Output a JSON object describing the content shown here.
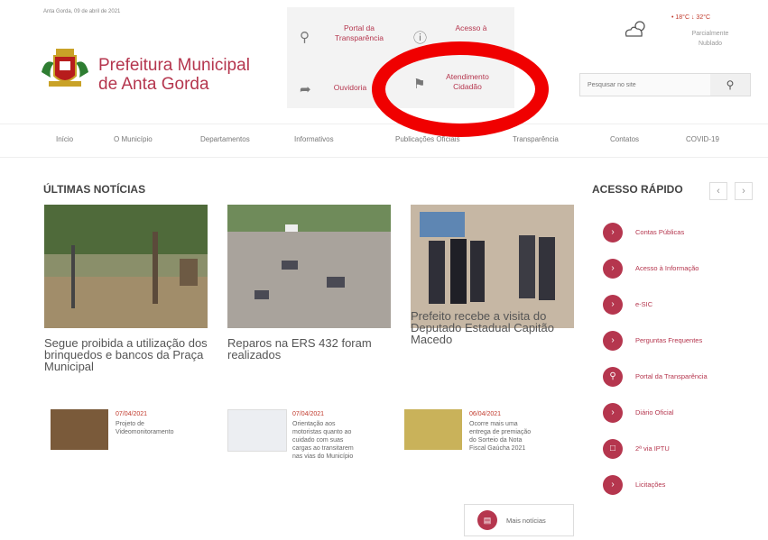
{
  "header": {
    "date_text": "Anta Gorda, 09 de abril de 2021",
    "brand_line1": "Prefeitura Municipal",
    "brand_line2": "de Anta Gorda",
    "quick_links": [
      {
        "label1": "Portal da",
        "label2": "Transparência",
        "icon": "search-icon"
      },
      {
        "label1": "Acesso à",
        "label2": "",
        "icon": "info-icon"
      },
      {
        "label1": "Ouvidoria",
        "label2": "",
        "icon": "megaphone-icon"
      },
      {
        "label1": "Atendimento",
        "label2": "Cidadão",
        "icon": "tags-icon"
      }
    ],
    "weather": {
      "temp": "• 18°C ↓ 32°C",
      "desc1": "Parcialmente",
      "desc2": "Nublado"
    },
    "search_placeholder": "Pesquisar no site"
  },
  "nav": [
    "Início",
    "O Município",
    "Departamentos",
    "Informativos",
    "Publicações Oficiais",
    "Transparência",
    "Contatos",
    "COVID-19"
  ],
  "news": {
    "title": "ÚLTIMAS NOTÍCIAS",
    "main": [
      {
        "title": "Segue proibida a utilização dos brinquedos e bancos da Praça Municipal"
      },
      {
        "title": "Reparos na ERS 432 foram realizados"
      },
      {
        "title": "Prefeito recebe a visita do Deputado Estadual Capitão Macedo"
      }
    ],
    "small": [
      {
        "date": "07/04/2021",
        "text": "Projeto de Videomonitoramento"
      },
      {
        "date": "07/04/2021",
        "text": "Orientação aos motoristas quanto ao cuidado com suas cargas ao transitarem nas vias do Município"
      },
      {
        "date": "06/04/2021",
        "text": "Ocorre mais uma entrega de premiação do Sorteio da Nota Fiscal Gaúcha 2021"
      }
    ],
    "more_label": "Mais notícias"
  },
  "quick_access": {
    "title": "ACESSO RÁPIDO",
    "items": [
      {
        "label": "Contas Públicas"
      },
      {
        "label": "Acesso à Informação"
      },
      {
        "label": "e-SIC"
      },
      {
        "label": "Perguntas Frequentes"
      },
      {
        "label": "Portal da Transparência"
      },
      {
        "label": "Diário Oficial"
      },
      {
        "label": "2ª via IPTU"
      },
      {
        "label": "Licitações"
      }
    ]
  },
  "colors": {
    "accent": "#b5364e",
    "annotation": "#f00000"
  }
}
